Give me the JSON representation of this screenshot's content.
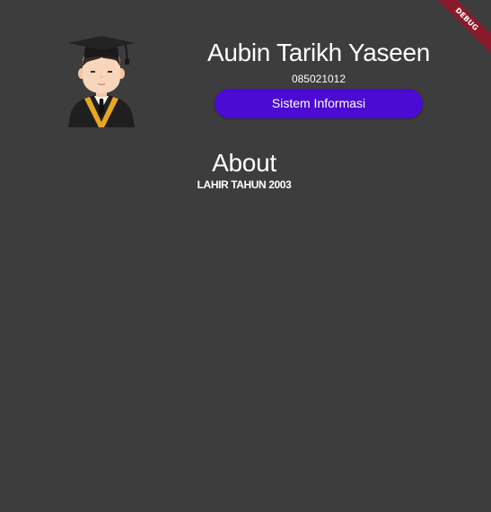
{
  "profile": {
    "avatar_icon": "graduate-avatar-icon",
    "name": "Aubin Tarikh Yaseen",
    "nim": "085021012",
    "major_button_label": "Sistem Informasi"
  },
  "about": {
    "title": "About",
    "text": "LAHIR TAHUN 2003"
  },
  "debug_banner": {
    "label": "DEBUG"
  },
  "colors": {
    "background": "#3d3d3d",
    "button": "#4b0bd3",
    "debug_ribbon": "#8a1a2a"
  }
}
